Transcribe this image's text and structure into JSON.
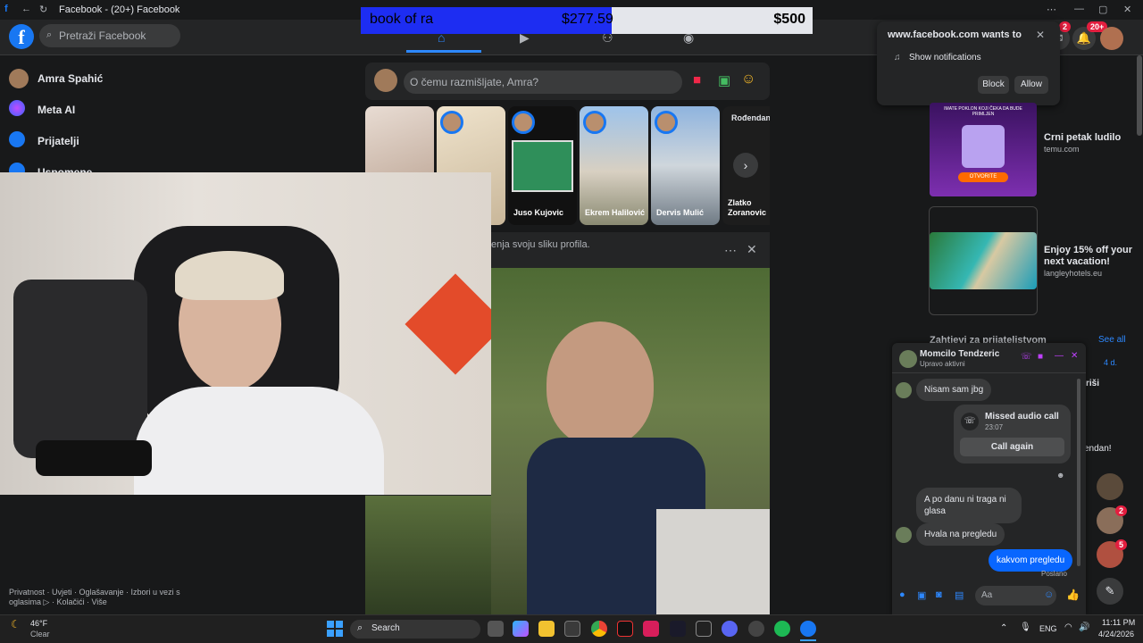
{
  "window": {
    "title": "Facebook - (20+) Facebook"
  },
  "banner": {
    "name": "book of ra",
    "value1": "$277.59",
    "value2": "$500"
  },
  "search": {
    "placeholder": "Pretraži Facebook"
  },
  "badges": {
    "messenger": "2",
    "notifications": "20+"
  },
  "sidebar": {
    "items": [
      {
        "label": "Amra Spahić"
      },
      {
        "label": "Meta AI"
      },
      {
        "label": "Prijatelji"
      },
      {
        "label": "Uspomene"
      }
    ],
    "footer": "Privatnost · Uvjeti · Oglašavanje · Izbori u vezi s oglasima ▷ · Kolačići · Više"
  },
  "composer": {
    "placeholder": "O čemu razmišljate, Amra?"
  },
  "stories": [
    {
      "name": ""
    },
    {
      "name": ""
    },
    {
      "name": "Juso Kujovic"
    },
    {
      "name": "Ekrem Halilović"
    },
    {
      "name": "Dervis Mulić"
    },
    {
      "name": "Zlatko Zoranovic",
      "tag": "Rođendan"
    }
  ],
  "post": {
    "text": "enja svoju sliku profila."
  },
  "notification": {
    "site": "www.facebook.com wants to",
    "item": "Show notifications",
    "block": "Block",
    "allow": "Allow"
  },
  "ads": [
    {
      "banner_top": "IMATE POKLON KOJI ČEKA DA BUDE PRIMLJEN",
      "banner_btn": "OTVORITE",
      "title": "Crni petak ludilo",
      "site": "temu.com"
    },
    {
      "title": "Enjoy 15% off your next vacation!",
      "site": "langleyhotels.eu"
    }
  ],
  "right": {
    "friend_requests": "Zahtjevi za prijateljstvom",
    "see_all": "See all",
    "time": "4 d.",
    "action": "riši",
    "bday": "endan!",
    "badge1": "2",
    "badge2": "5"
  },
  "chat": {
    "name": "Momcilo Tendzeric",
    "status": "Upravo aktivni",
    "m1": "Nisam sam jbg",
    "call_title": "Missed audio call",
    "call_time": "23:07",
    "call_again": "Call again",
    "m2": "A po danu ni traga ni glasa",
    "m3": "Hvala na pregledu",
    "m4": "kakvom pregledu",
    "sent": "Poslano",
    "input": "Aa"
  },
  "taskbar": {
    "temp": "46°F",
    "weather": "Clear",
    "search": "Search",
    "lang": "ENG",
    "time": "11:11 PM",
    "date": "4/24/2026"
  }
}
